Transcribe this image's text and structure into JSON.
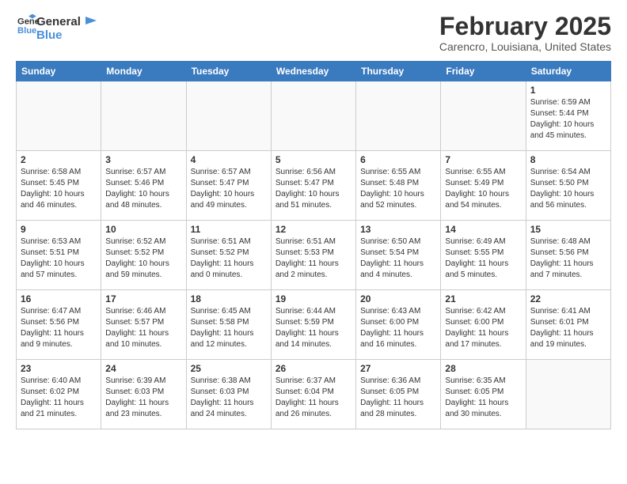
{
  "header": {
    "logo_line1": "General",
    "logo_line2": "Blue",
    "month_title": "February 2025",
    "location": "Carencro, Louisiana, United States"
  },
  "weekdays": [
    "Sunday",
    "Monday",
    "Tuesday",
    "Wednesday",
    "Thursday",
    "Friday",
    "Saturday"
  ],
  "weeks": [
    [
      {
        "day": "",
        "info": ""
      },
      {
        "day": "",
        "info": ""
      },
      {
        "day": "",
        "info": ""
      },
      {
        "day": "",
        "info": ""
      },
      {
        "day": "",
        "info": ""
      },
      {
        "day": "",
        "info": ""
      },
      {
        "day": "1",
        "info": "Sunrise: 6:59 AM\nSunset: 5:44 PM\nDaylight: 10 hours\nand 45 minutes."
      }
    ],
    [
      {
        "day": "2",
        "info": "Sunrise: 6:58 AM\nSunset: 5:45 PM\nDaylight: 10 hours\nand 46 minutes."
      },
      {
        "day": "3",
        "info": "Sunrise: 6:57 AM\nSunset: 5:46 PM\nDaylight: 10 hours\nand 48 minutes."
      },
      {
        "day": "4",
        "info": "Sunrise: 6:57 AM\nSunset: 5:47 PM\nDaylight: 10 hours\nand 49 minutes."
      },
      {
        "day": "5",
        "info": "Sunrise: 6:56 AM\nSunset: 5:47 PM\nDaylight: 10 hours\nand 51 minutes."
      },
      {
        "day": "6",
        "info": "Sunrise: 6:55 AM\nSunset: 5:48 PM\nDaylight: 10 hours\nand 52 minutes."
      },
      {
        "day": "7",
        "info": "Sunrise: 6:55 AM\nSunset: 5:49 PM\nDaylight: 10 hours\nand 54 minutes."
      },
      {
        "day": "8",
        "info": "Sunrise: 6:54 AM\nSunset: 5:50 PM\nDaylight: 10 hours\nand 56 minutes."
      }
    ],
    [
      {
        "day": "9",
        "info": "Sunrise: 6:53 AM\nSunset: 5:51 PM\nDaylight: 10 hours\nand 57 minutes."
      },
      {
        "day": "10",
        "info": "Sunrise: 6:52 AM\nSunset: 5:52 PM\nDaylight: 10 hours\nand 59 minutes."
      },
      {
        "day": "11",
        "info": "Sunrise: 6:51 AM\nSunset: 5:52 PM\nDaylight: 11 hours\nand 0 minutes."
      },
      {
        "day": "12",
        "info": "Sunrise: 6:51 AM\nSunset: 5:53 PM\nDaylight: 11 hours\nand 2 minutes."
      },
      {
        "day": "13",
        "info": "Sunrise: 6:50 AM\nSunset: 5:54 PM\nDaylight: 11 hours\nand 4 minutes."
      },
      {
        "day": "14",
        "info": "Sunrise: 6:49 AM\nSunset: 5:55 PM\nDaylight: 11 hours\nand 5 minutes."
      },
      {
        "day": "15",
        "info": "Sunrise: 6:48 AM\nSunset: 5:56 PM\nDaylight: 11 hours\nand 7 minutes."
      }
    ],
    [
      {
        "day": "16",
        "info": "Sunrise: 6:47 AM\nSunset: 5:56 PM\nDaylight: 11 hours\nand 9 minutes."
      },
      {
        "day": "17",
        "info": "Sunrise: 6:46 AM\nSunset: 5:57 PM\nDaylight: 11 hours\nand 10 minutes."
      },
      {
        "day": "18",
        "info": "Sunrise: 6:45 AM\nSunset: 5:58 PM\nDaylight: 11 hours\nand 12 minutes."
      },
      {
        "day": "19",
        "info": "Sunrise: 6:44 AM\nSunset: 5:59 PM\nDaylight: 11 hours\nand 14 minutes."
      },
      {
        "day": "20",
        "info": "Sunrise: 6:43 AM\nSunset: 6:00 PM\nDaylight: 11 hours\nand 16 minutes."
      },
      {
        "day": "21",
        "info": "Sunrise: 6:42 AM\nSunset: 6:00 PM\nDaylight: 11 hours\nand 17 minutes."
      },
      {
        "day": "22",
        "info": "Sunrise: 6:41 AM\nSunset: 6:01 PM\nDaylight: 11 hours\nand 19 minutes."
      }
    ],
    [
      {
        "day": "23",
        "info": "Sunrise: 6:40 AM\nSunset: 6:02 PM\nDaylight: 11 hours\nand 21 minutes."
      },
      {
        "day": "24",
        "info": "Sunrise: 6:39 AM\nSunset: 6:03 PM\nDaylight: 11 hours\nand 23 minutes."
      },
      {
        "day": "25",
        "info": "Sunrise: 6:38 AM\nSunset: 6:03 PM\nDaylight: 11 hours\nand 24 minutes."
      },
      {
        "day": "26",
        "info": "Sunrise: 6:37 AM\nSunset: 6:04 PM\nDaylight: 11 hours\nand 26 minutes."
      },
      {
        "day": "27",
        "info": "Sunrise: 6:36 AM\nSunset: 6:05 PM\nDaylight: 11 hours\nand 28 minutes."
      },
      {
        "day": "28",
        "info": "Sunrise: 6:35 AM\nSunset: 6:05 PM\nDaylight: 11 hours\nand 30 minutes."
      },
      {
        "day": "",
        "info": ""
      }
    ]
  ]
}
